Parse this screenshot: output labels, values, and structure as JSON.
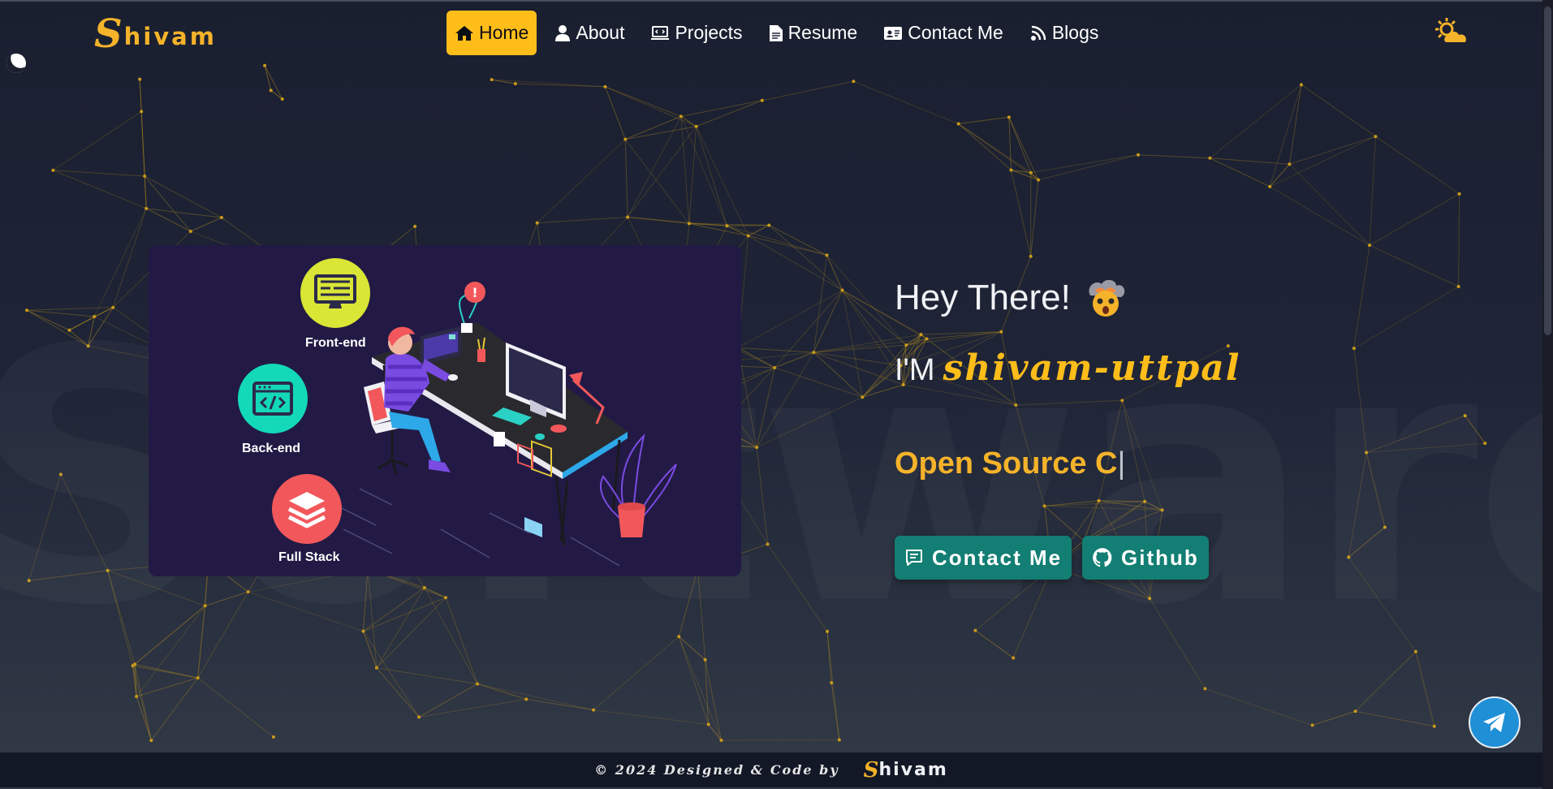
{
  "brand": {
    "logo_initial": "S",
    "logo_rest": "hivam"
  },
  "nav": {
    "items": [
      {
        "label": "Home",
        "icon": "home-icon",
        "active": true
      },
      {
        "label": "About",
        "icon": "user-icon",
        "active": false
      },
      {
        "label": "Projects",
        "icon": "laptop-code-icon",
        "active": false
      },
      {
        "label": "Resume",
        "icon": "file-icon",
        "active": false
      },
      {
        "label": "Contact Me",
        "icon": "id-card-icon",
        "active": false
      },
      {
        "label": "Blogs",
        "icon": "blog-icon",
        "active": false
      }
    ]
  },
  "theme_toggle": {
    "icon": "sun-cloud-icon"
  },
  "background_word": "SoftwareDev",
  "illustration": {
    "badges": [
      {
        "label": "Front-end",
        "icon": "monitor-icon",
        "color": "#d9e635"
      },
      {
        "label": "Back-end",
        "icon": "code-window-icon",
        "color": "#13d9b8"
      },
      {
        "label": "Full Stack",
        "icon": "layers-icon",
        "color": "#f2585b"
      }
    ]
  },
  "hero": {
    "greeting": "Hey There!",
    "greeting_emoji": "exploding-head-emoji",
    "intro": "I'M",
    "name": "shivam-uttpal",
    "typed_text": "Open Source C",
    "typed_cursor": "|"
  },
  "buttons": {
    "contact": {
      "label": "Contact Me",
      "icon": "chat-icon"
    },
    "github": {
      "label": "Github",
      "icon": "github-icon"
    }
  },
  "telegram": {
    "icon": "telegram-icon"
  },
  "footer": {
    "text": "© 2024 Designed & Code by",
    "logo_initial": "S",
    "logo_rest": "hivam"
  },
  "colors": {
    "accent": "#ffbd1a",
    "button": "#137e73",
    "card": "#221a45",
    "line": "#c99a1a"
  }
}
